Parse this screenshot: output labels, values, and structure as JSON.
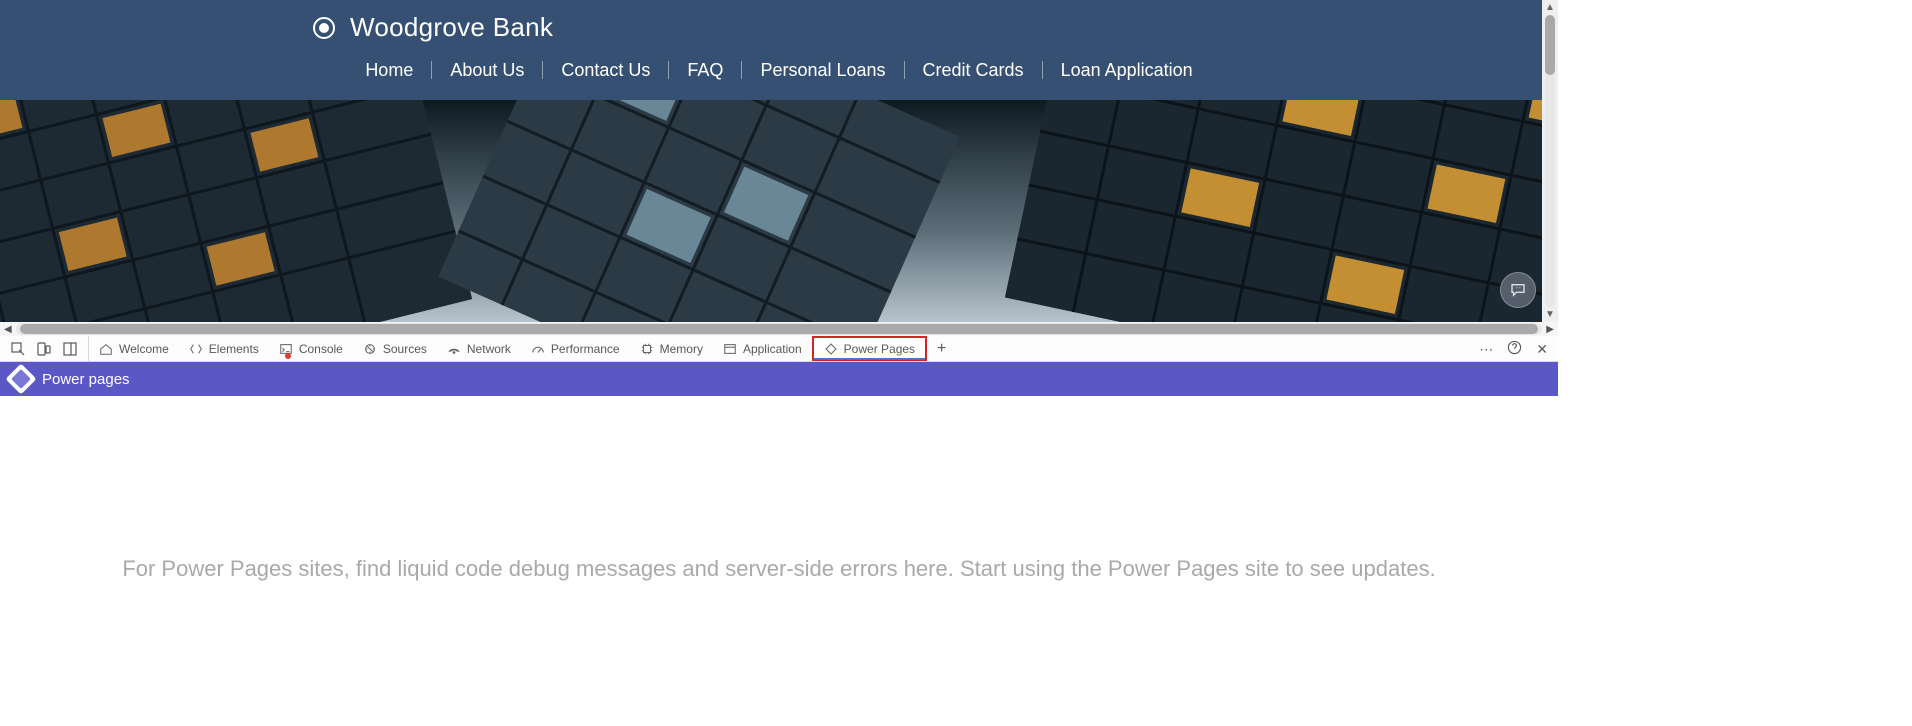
{
  "site": {
    "brand": "Woodgrove Bank",
    "nav": {
      "home": "Home",
      "about": "About Us",
      "contact": "Contact Us",
      "faq": "FAQ",
      "loans": "Personal Loans",
      "credit": "Credit Cards",
      "apply": "Loan Application"
    }
  },
  "devtools": {
    "tabs": {
      "welcome": "Welcome",
      "elements": "Elements",
      "console": "Console",
      "sources": "Sources",
      "network": "Network",
      "performance": "Performance",
      "memory": "Memory",
      "application": "Application",
      "powerpages": "Power Pages"
    }
  },
  "powerpages": {
    "title": "Power pages",
    "body_message": "For Power Pages sites, find liquid code debug messages and server-side errors here. Start using the Power Pages site to see updates."
  }
}
